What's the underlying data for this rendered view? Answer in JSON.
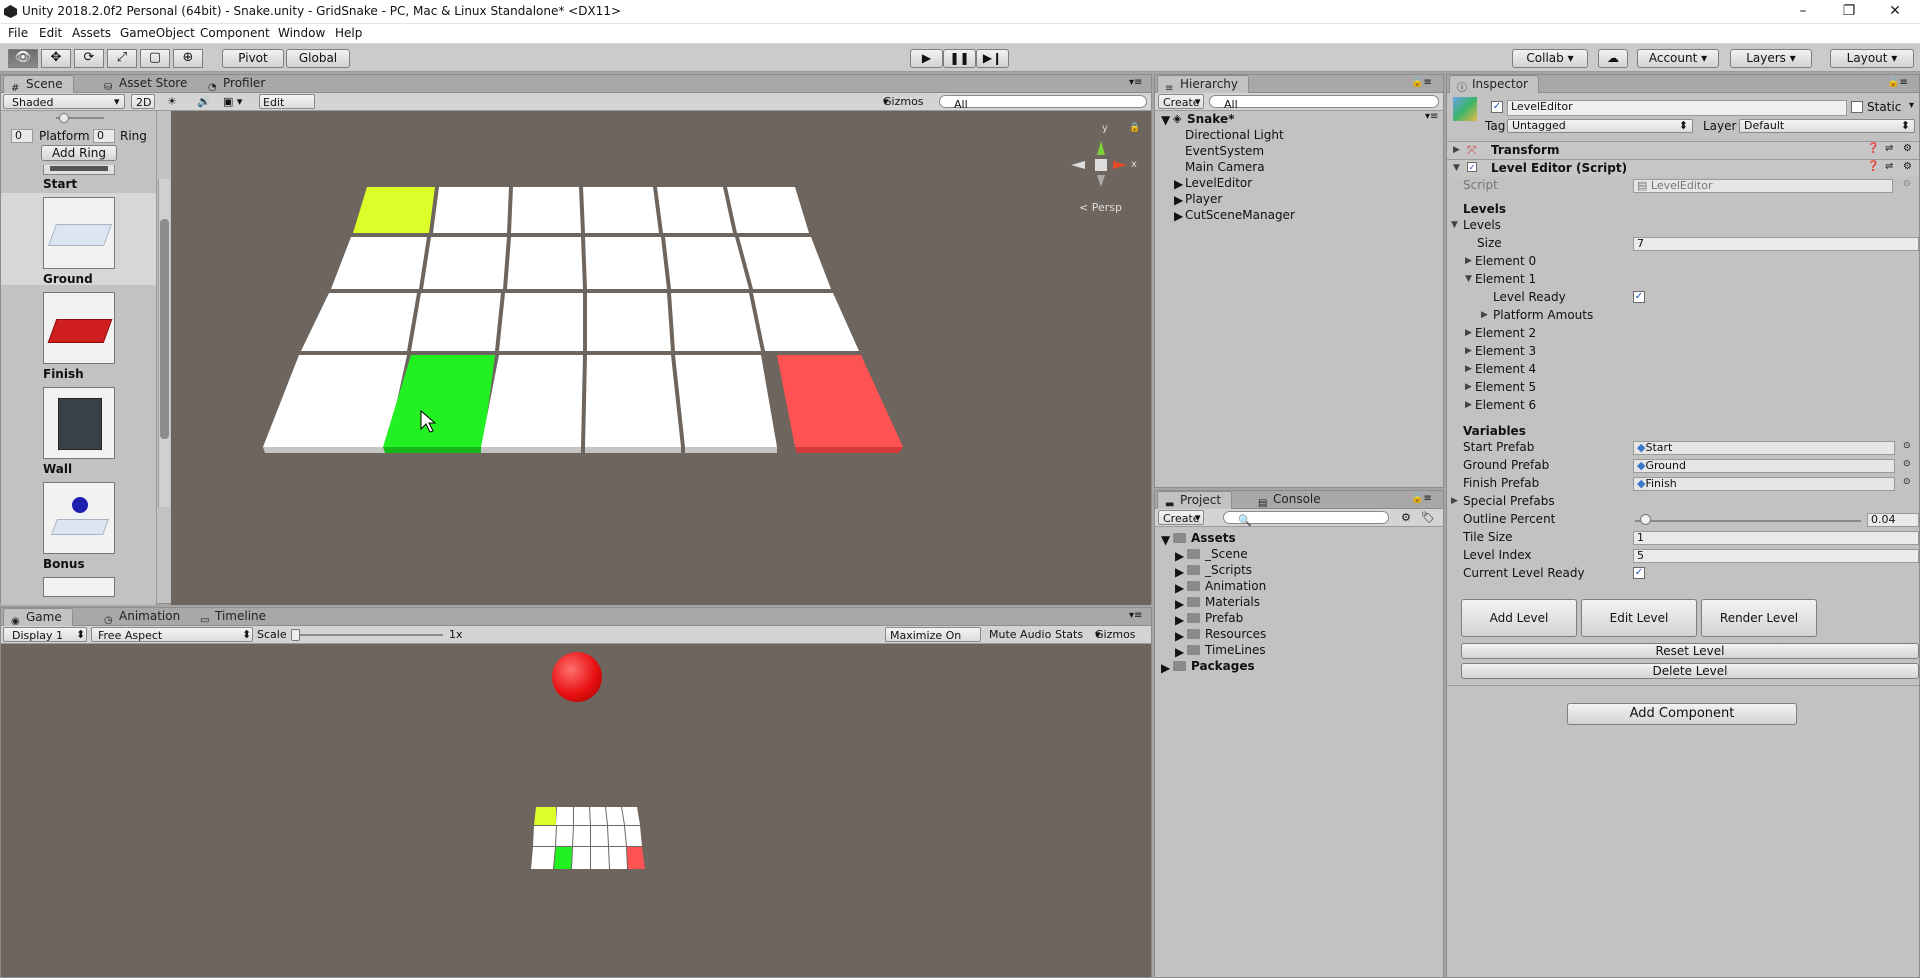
{
  "window": {
    "title": "Unity 2018.2.0f2 Personal (64bit) - Snake.unity - GridSnake - PC, Mac & Linux Standalone* <DX11>",
    "minimize": "–",
    "restore": "❐",
    "close": "✕"
  },
  "menu": [
    "File",
    "Edit",
    "Assets",
    "GameObject",
    "Component",
    "Window",
    "Help"
  ],
  "toolbar": {
    "pivot": "Pivot",
    "global": "Global",
    "play_icon": "play-icon",
    "pause_icon": "pause-icon",
    "step_icon": "step-icon",
    "collab": "Collab",
    "account": "Account",
    "layers": "Layers",
    "layout": "Layout"
  },
  "scene_panel": {
    "tabs": [
      "Scene",
      "Asset Store",
      "Profiler"
    ],
    "shaded": "Shaded",
    "two_d": "2D",
    "edit_level": "Edit Level",
    "gizmos": "Gizmos",
    "search_placeholder": "All",
    "persp": "< Persp",
    "gizmo_y": "y",
    "gizmo_x": "x"
  },
  "palette": {
    "platform_value": "0",
    "platform_label": "Platform",
    "ring_value": "0",
    "ring_label": "Ring",
    "add_ring": "Add Ring",
    "items": [
      "Start",
      "Ground",
      "Finish",
      "Wall",
      "Bonus"
    ]
  },
  "game_panel": {
    "tabs": [
      "Game",
      "Animation",
      "Timeline"
    ],
    "display": "Display 1",
    "aspect": "Free Aspect",
    "scale_label": "Scale",
    "scale_value": "1x",
    "maximize": "Maximize On Play",
    "mute": "Mute Audio",
    "stats": "Stats",
    "gizmos": "Gizmos"
  },
  "hierarchy": {
    "tab": "Hierarchy",
    "create": "Create",
    "search_placeholder": "All",
    "scene": "Snake*",
    "items": [
      "Directional Light",
      "EventSystem",
      "Main Camera",
      "LevelEditor",
      "Player",
      "CutSceneManager"
    ]
  },
  "project": {
    "tabs": [
      "Project",
      "Console"
    ],
    "create": "Create",
    "root": "Assets",
    "folders": [
      "_Scene",
      "_Scripts",
      "Animation",
      "Materials",
      "Prefab",
      "Resources",
      "TimeLines"
    ],
    "packages": "Packages"
  },
  "inspector": {
    "tab": "Inspector",
    "object_name": "LevelEditor",
    "static": "Static",
    "tag_label": "Tag",
    "tag_value": "Untagged",
    "layer_label": "Layer",
    "layer_value": "Default",
    "transform": "Transform",
    "component": "Level Editor (Script)",
    "script_label": "Script",
    "script_value": "LevelEditor",
    "levels_header": "Levels",
    "levels_fold": "Levels",
    "size_label": "Size",
    "size_value": "7",
    "elements": [
      "Element 0",
      "Element 1",
      "Element 2",
      "Element 3",
      "Element 4",
      "Element 5",
      "Element 6"
    ],
    "level_ready": "Level Ready",
    "platform_amounts": "Platform Amouts",
    "variables_header": "Variables",
    "start_prefab_label": "Start Prefab",
    "start_prefab_value": "Start",
    "ground_prefab_label": "Ground Prefab",
    "ground_prefab_value": "Ground",
    "finish_prefab_label": "Finish Prefab",
    "finish_prefab_value": "Finish",
    "special_prefabs": "Special Prefabs",
    "outline_label": "Outline Percent",
    "outline_value": "0.04",
    "outline_fraction": 0.02,
    "tile_size_label": "Tile Size",
    "tile_size_value": "1",
    "level_index_label": "Level Index",
    "level_index_value": "5",
    "current_ready_label": "Current Level Ready",
    "add_level": "Add Level",
    "edit_level": "Edit Level",
    "render_level": "Render Level",
    "reset_level": "Reset Level",
    "delete_level": "Delete Level",
    "add_component": "Add Component"
  },
  "colors": {
    "yellow": "#dcff2a",
    "green": "#22f022",
    "red": "#ff5252",
    "ball": "#e81010",
    "viewport": "#6d655e"
  }
}
